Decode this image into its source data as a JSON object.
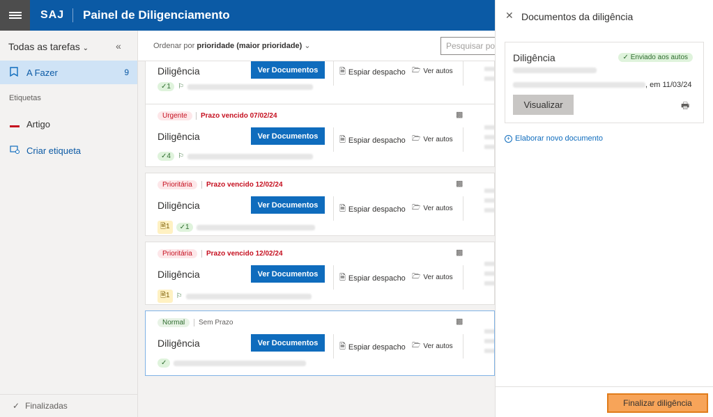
{
  "header": {
    "logo": "SAJ",
    "title": "Painel de Diligenciamento"
  },
  "sidebar": {
    "heading": "Todas as tarefas",
    "collapse_icon": "«",
    "items": [
      {
        "label": "A Fazer",
        "count": "9"
      },
      {
        "label": "Etiquetas"
      },
      {
        "label": "Artigo"
      },
      {
        "label": "Criar etiqueta"
      }
    ],
    "bottom": "Finalizadas"
  },
  "sortbar": {
    "prefix": "Ordenar por",
    "value": "prioridade (maior prioridade)",
    "search_placeholder": "Pesquisar por"
  },
  "cards": [
    {
      "title": "Diligência",
      "docs_btn": "Ver Documentos",
      "espiar": "Espiar despacho",
      "autos": "Ver autos",
      "check_count": "1"
    },
    {
      "badge": "Urgente",
      "prazo": "Prazo vencido 07/02/24",
      "title": "Diligência",
      "docs_btn": "Ver Documentos",
      "espiar": "Espiar despacho",
      "autos": "Ver autos",
      "check_count": "4"
    },
    {
      "badge": "Prioritária",
      "prazo": "Prazo vencido 12/02/24",
      "title": "Diligência",
      "docs_btn": "Ver Documentos",
      "espiar": "Espiar despacho",
      "autos": "Ver autos",
      "doc_count": "1",
      "check_count": "1"
    },
    {
      "badge": "Prioritária",
      "prazo": "Prazo vencido 12/02/24",
      "title": "Diligência",
      "docs_btn": "Ver Documentos",
      "espiar": "Espiar despacho",
      "autos": "Ver autos",
      "doc_count": "1"
    },
    {
      "badge": "Normal",
      "prazo": "Sem Prazo",
      "title": "Diligência",
      "docs_btn": "Ver Documentos",
      "espiar": "Espiar despacho",
      "autos": "Ver autos"
    }
  ],
  "panel": {
    "title": "Documentos da diligência",
    "doc_name": "Diligência",
    "status": "Enviado aos autos",
    "date": ", em 11/03/24",
    "visualizar": "Visualizar",
    "elaborar": "Elaborar novo documento",
    "finalizar": "Finalizar diligência"
  },
  "colors": {
    "brand": "#0b5aa5",
    "primary_button": "#0f6cbd",
    "finalize": "#f7a459",
    "danger": "#c50f1f"
  }
}
